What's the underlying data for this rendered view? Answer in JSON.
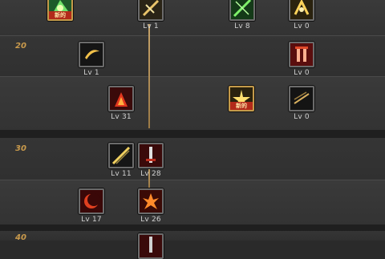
{
  "level_markers": [
    "20",
    "30",
    "40"
  ],
  "skills": [
    {
      "id": "nature-strike",
      "level_text": "",
      "badge": "新的",
      "highlighted": true
    },
    {
      "id": "sword-dash",
      "level_text": "Lv 1",
      "badge": "",
      "highlighted": false
    },
    {
      "id": "blade-lock",
      "level_text": "Lv 8",
      "badge": "",
      "highlighted": false
    },
    {
      "id": "golden-slash",
      "level_text": "Lv 0",
      "badge": "",
      "highlighted": false
    },
    {
      "id": "crescent-wind",
      "level_text": "Lv 1",
      "badge": "",
      "highlighted": false
    },
    {
      "id": "crimson-pillar",
      "level_text": "Lv 0",
      "badge": "",
      "highlighted": false
    },
    {
      "id": "flame-kick",
      "level_text": "Lv 31",
      "badge": "",
      "highlighted": false
    },
    {
      "id": "star-burst",
      "level_text": "",
      "badge": "新的",
      "highlighted": true
    },
    {
      "id": "shadow-claw",
      "level_text": "Lv 0",
      "badge": "",
      "highlighted": false
    },
    {
      "id": "lightning-thrust",
      "level_text": "Lv 11",
      "badge": "",
      "highlighted": false
    },
    {
      "id": "blood-blade",
      "level_text": "Lv 28",
      "badge": "",
      "highlighted": false
    },
    {
      "id": "fire-crescent",
      "level_text": "Lv 17",
      "badge": "",
      "highlighted": false
    },
    {
      "id": "flare-burst",
      "level_text": "Lv 26",
      "badge": "",
      "highlighted": false
    }
  ]
}
